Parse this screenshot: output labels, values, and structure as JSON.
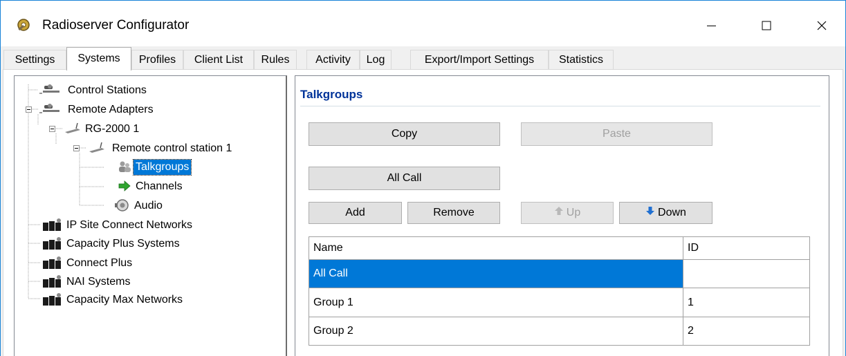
{
  "window": {
    "title": "Radioserver Configurator",
    "icon": "gear-wrench-app-icon",
    "controls": [
      "minimize-icon",
      "maximize-icon",
      "close-icon"
    ]
  },
  "tabs": [
    {
      "label": "Settings",
      "active": false
    },
    {
      "label": "Systems",
      "active": true
    },
    {
      "label": "Profiles",
      "active": false
    },
    {
      "label": "Client List",
      "active": false
    },
    {
      "label": "Rules",
      "active": false
    },
    {
      "label": "Activity",
      "active": false
    },
    {
      "label": "Log",
      "active": false
    },
    {
      "label": "Export/Import Settings",
      "active": false
    },
    {
      "label": "Statistics",
      "active": false
    }
  ],
  "tree": {
    "nodes": [
      {
        "label": "Control Stations",
        "icon": "control-station-icon"
      },
      {
        "label": "Remote Adapters",
        "icon": "control-station-icon",
        "expanded": true
      },
      {
        "label": "RG-2000 1",
        "icon": "radio-gateway-icon",
        "expanded": true
      },
      {
        "label": "Remote control station 1",
        "icon": "radio-gateway-icon",
        "expanded": true
      },
      {
        "label": "Talkgroups",
        "icon": "users-icon",
        "selected": true
      },
      {
        "label": "Channels",
        "icon": "green-arrow-icon"
      },
      {
        "label": "Audio",
        "icon": "speaker-icon"
      },
      {
        "label": "IP Site Connect Networks",
        "icon": "network-icon"
      },
      {
        "label": "Capacity Plus Systems",
        "icon": "network-icon"
      },
      {
        "label": "Connect Plus",
        "icon": "network-icon"
      },
      {
        "label": "NAI Systems",
        "icon": "network-icon"
      },
      {
        "label": "Capacity Max Networks",
        "icon": "network-icon"
      }
    ]
  },
  "panel": {
    "title": "Talkgroups",
    "buttons": {
      "copy": "Copy",
      "paste": "Paste",
      "all_call": "All Call",
      "add": "Add",
      "remove": "Remove",
      "up": "Up",
      "down": "Down"
    }
  },
  "grid": {
    "columns": [
      "Name",
      "ID"
    ],
    "rows": [
      {
        "name": "All Call",
        "id": "",
        "selected": true
      },
      {
        "name": "Group 1",
        "id": "1",
        "selected": false
      },
      {
        "name": "Group 2",
        "id": "2",
        "selected": false
      }
    ]
  },
  "colors": {
    "selection": "#0078d7",
    "group_title": "#003399",
    "window_border": "#1883d7"
  }
}
